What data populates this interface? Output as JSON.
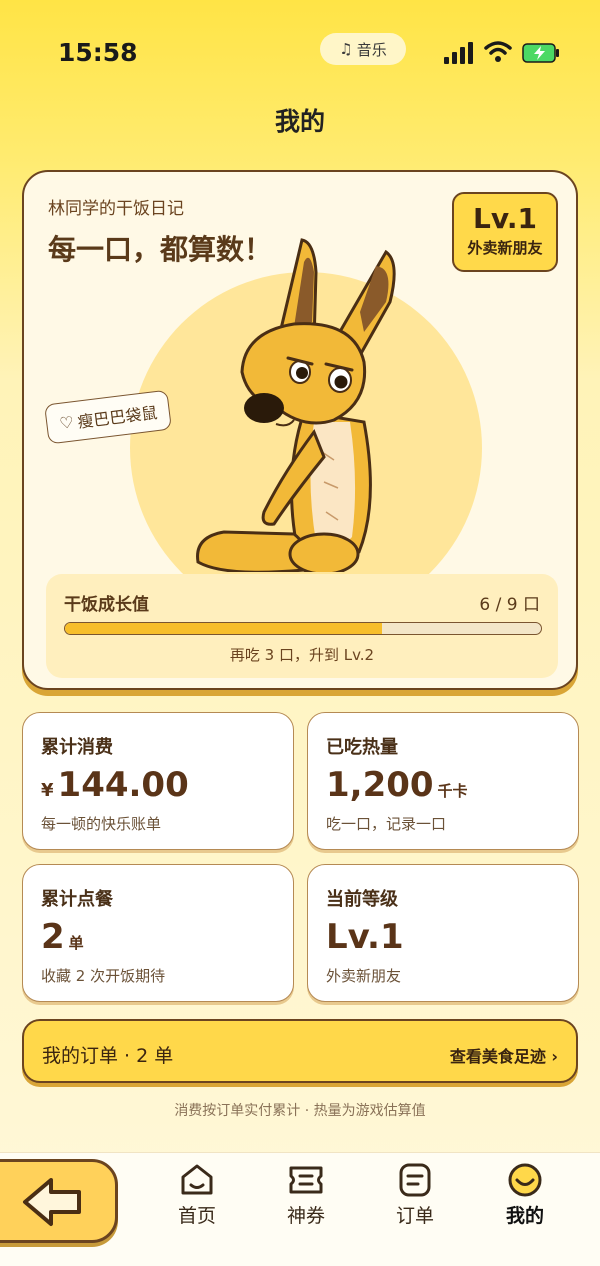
{
  "status_bar": {
    "time": "15:58",
    "music_label": "音乐"
  },
  "page": {
    "title": "我的"
  },
  "hero": {
    "subtitle": "林同学的干饭日记",
    "title": "每一口，都算数！",
    "level": {
      "label": "Lv.1",
      "name": "外卖新朋友"
    },
    "pet_tag": "瘦巴巴袋鼠",
    "growth": {
      "label": "干饭成长值",
      "count": "6 / 9 口",
      "current": 6,
      "max": 9,
      "hint": "再吃 3 口，升到 Lv.2"
    }
  },
  "stats": [
    {
      "label": "累计消费",
      "currency": "¥",
      "value": "144.00",
      "unit": "",
      "desc": "每一顿的快乐账单"
    },
    {
      "label": "已吃热量",
      "currency": "",
      "value": "1,200",
      "unit": "千卡",
      "desc": "吃一口，记录一口"
    },
    {
      "label": "累计点餐",
      "currency": "",
      "value": "2",
      "unit": "单",
      "desc": "收藏 2 次开饭期待"
    },
    {
      "label": "当前等级",
      "currency": "",
      "value": "Lv.1",
      "unit": "",
      "desc": "外卖新朋友"
    }
  ],
  "orders": {
    "label": "我的订单 · 2 单",
    "link": "查看美食足迹 ›"
  },
  "footnote": "消费按订单实付累计 · 热量为游戏估算值",
  "nav": {
    "items": [
      {
        "label": "首页",
        "icon": "home-icon"
      },
      {
        "label": "神券",
        "icon": "coupon-icon"
      },
      {
        "label": "订单",
        "icon": "order-icon"
      },
      {
        "label": "我的",
        "icon": "smiley-icon",
        "active": true
      }
    ]
  },
  "colors": {
    "accent": "#FFD84A",
    "brown": "#6B4420",
    "progress": "#F7BE2A"
  }
}
